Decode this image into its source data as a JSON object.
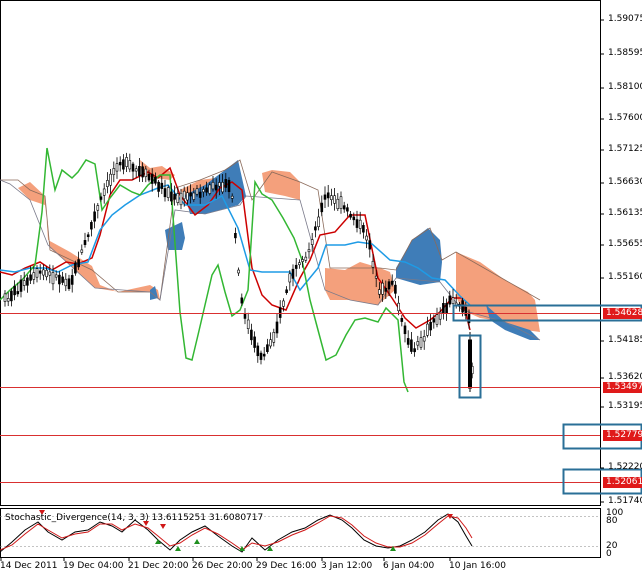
{
  "chart_title": "",
  "price_axis": {
    "ticks": [
      "1.59075",
      "1.58595",
      "1.58100",
      "1.57600",
      "1.57125",
      "1.56630",
      "1.56135",
      "1.55655",
      "1.55160",
      "1.54185",
      "1.53620",
      "1.53195",
      "1.52220",
      "1.51740"
    ],
    "badges": [
      "1.54628",
      "1.53497",
      "1.52779",
      "1.52061"
    ]
  },
  "time_axis": {
    "labels": [
      "14 Dec 2011",
      "19 Dec 04:00",
      "21 Dec 20:00",
      "26 Dec 20:00",
      "29 Dec 16:00",
      "3 Jan 12:00",
      "6 Jan 04:00",
      "10 Jan 16:00"
    ]
  },
  "indicator": {
    "title": "Stochastic_Divergence(14, 3, 3) 13.6115251 31.6080717",
    "levels": [
      "100",
      "80",
      "20",
      "0"
    ]
  },
  "colors": {
    "tenkan": "#cc0000",
    "kijun": "#1e9be6",
    "chikou": "#33b733",
    "cloud_bull": "#f4a07c",
    "cloud_bear": "#3f7db8",
    "level_line": "#d93030",
    "box": "#2a6f97"
  }
}
